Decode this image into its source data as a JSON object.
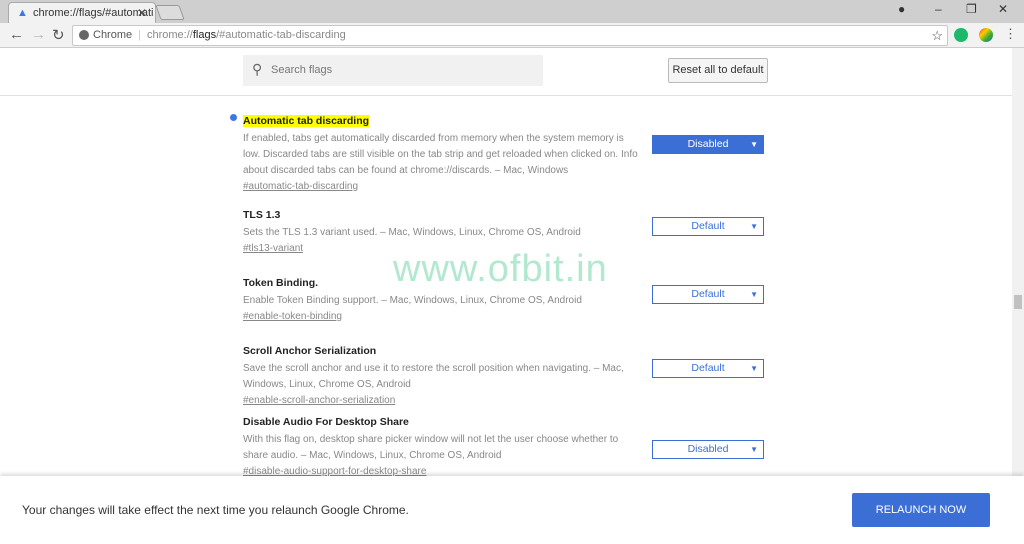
{
  "tab": {
    "title": "chrome://flags/#automati",
    "icon": "flask-icon"
  },
  "toolbar": {
    "site": "Chrome",
    "url_prefix": "chrome://",
    "url_host": "flags",
    "url_rest": "/#automatic-tab-discarding"
  },
  "header": {
    "search_placeholder": "Search flags",
    "reset_label": "Reset all to default"
  },
  "flags": [
    {
      "title": "Automatic tab discarding",
      "description": "If enabled, tabs get automatically discarded from memory when the system memory is low. Discarded tabs are still visible on the tab strip and get reloaded when clicked on. Info about discarded tabs can be found at chrome://discards. – Mac, Windows",
      "link": "#automatic-tab-discarding",
      "value": "Disabled",
      "modified": true
    },
    {
      "title": "TLS 1.3",
      "description": "Sets the TLS 1.3 variant used. – Mac, Windows, Linux, Chrome OS, Android",
      "link": "#tls13-variant",
      "value": "Default",
      "modified": false
    },
    {
      "title": "Token Binding.",
      "description": "Enable Token Binding support. – Mac, Windows, Linux, Chrome OS, Android",
      "link": "#enable-token-binding",
      "value": "Default",
      "modified": false
    },
    {
      "title": "Scroll Anchor Serialization",
      "description": "Save the scroll anchor and use it to restore the scroll position when navigating. – Mac, Windows, Linux, Chrome OS, Android",
      "link": "#enable-scroll-anchor-serialization",
      "value": "Default",
      "modified": false
    },
    {
      "title": "Disable Audio For Desktop Share",
      "description": "With this flag on, desktop share picker window will not let the user choose whether to share audio. – Mac, Windows, Linux, Chrome OS, Android",
      "link": "#disable-audio-support-for-desktop-share",
      "value": "Disabled",
      "modified": false
    }
  ],
  "watermark": "www.ofbit.in",
  "footer": {
    "message": "Your changes will take effect the next time you relaunch Google Chrome.",
    "button": "RELAUNCH NOW"
  },
  "colors": {
    "accent": "#3b6fd6",
    "highlight": "#ffff00"
  }
}
